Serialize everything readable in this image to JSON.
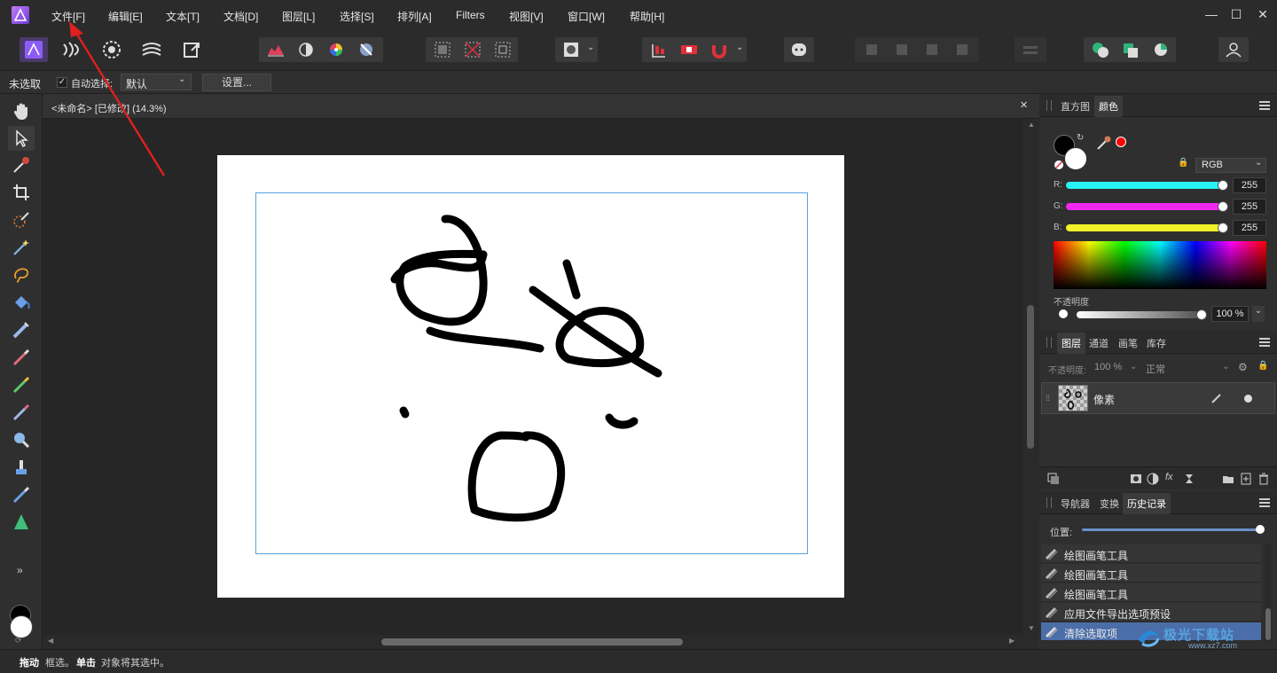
{
  "menu": {
    "items": [
      "文件[F]",
      "编辑[E]",
      "文本[T]",
      "文档[D]",
      "图层[L]",
      "选择[S]",
      "排列[A]",
      "Filters",
      "视图[V]",
      "窗口[W]",
      "帮助[H]"
    ]
  },
  "window_controls": {
    "minimize": "—",
    "maximize": "☐",
    "close": "✕"
  },
  "context_bar": {
    "selection_status": "未选取",
    "auto_select_label": "自动选择:",
    "auto_select_checked": true,
    "auto_select_value": "默认",
    "settings_button": "设置..."
  },
  "document_tab": {
    "title": "<未命名> [已修改] (14.3%)",
    "close": "✕"
  },
  "left_tools": [
    "hand-icon",
    "move-icon",
    "color-picker-icon",
    "crop-icon",
    "selection-brush-icon",
    "flood-select-icon",
    "freehand-select-icon",
    "flood-fill-icon",
    "paint-mixer-icon",
    "paint-brush-icon",
    "pixel-brush-icon",
    "erase-brush-icon",
    "zoom-icon",
    "clone-icon",
    "smudge-icon",
    "sharpen-icon"
  ],
  "left_more": "»",
  "right_panel": {
    "color_panel": {
      "tabs": [
        "直方图",
        "颜色"
      ],
      "active_tab": "颜色",
      "mode": "RGB",
      "channels": [
        {
          "label": "R:",
          "value": "255",
          "color": "#28f2f2"
        },
        {
          "label": "G:",
          "value": "255",
          "color": "#f228f2"
        },
        {
          "label": "B:",
          "value": "255",
          "color": "#f2f228"
        }
      ],
      "opacity_label": "不透明度",
      "opacity_value": "100 %",
      "opacity_dropdown": "⌄",
      "accent_swatch": "#ff0000"
    },
    "layers_panel": {
      "tabs": [
        "图层",
        "通道",
        "画笔",
        "库存"
      ],
      "active_tab": "图层",
      "opacity_label": "不透明度:",
      "opacity_value": "100 %",
      "blend_mode": "正常",
      "layers": [
        {
          "name": "像素"
        }
      ]
    },
    "history_panel": {
      "tabs": [
        "导航器",
        "变换",
        "历史记录"
      ],
      "active_tab": "历史记录",
      "position_label": "位置:",
      "position_fraction": 1.0,
      "items": [
        {
          "label": "绘图画笔工具",
          "selected": false
        },
        {
          "label": "绘图画笔工具",
          "selected": false
        },
        {
          "label": "绘图画笔工具",
          "selected": false
        },
        {
          "label": "应用文件导出选项预设",
          "selected": false
        },
        {
          "label": "清除选取项",
          "selected": true
        }
      ]
    }
  },
  "status_bar": {
    "drag_bold": "拖动",
    "drag_text": "框选。",
    "click_bold": "单击",
    "click_text": "对象将其选中。"
  },
  "watermark": {
    "text": "极光下载站",
    "url": "www.xz7.com"
  },
  "colors": {
    "selection_highlight": "#4b6ea8",
    "annotation_arrow": "#e0201e",
    "app_accent": "#8b5cf6"
  }
}
